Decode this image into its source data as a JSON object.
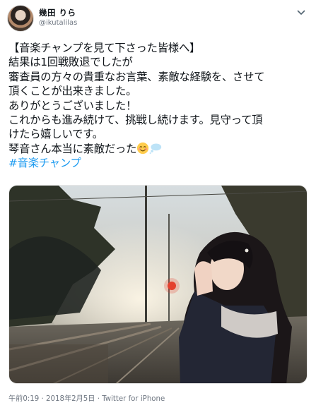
{
  "author": {
    "display_name": "幾田 りら",
    "handle": "@ikutalilas"
  },
  "tweet": {
    "lines": [
      "【音楽チャンプを見て下さった皆様へ】",
      "結果は1回戦敗退でしたが",
      "審査員の方々の貴重なお言葉、素敵な経験を、させて",
      "頂くことが出来きました。",
      "ありがとうございました！",
      "これからも進み続けて、挑戦し続けます。見守って頂",
      "けたら嬉しいです。",
      "琴音さん本当に素敵だった"
    ],
    "hashtag": "#音楽チャンプ",
    "emojis": [
      "smiling-blush-emoji",
      "thought-bubble-emoji"
    ]
  },
  "meta": {
    "time": "午前0:19",
    "date": "2018年2月5日",
    "separator": "·",
    "source": "Twitter for iPhone"
  },
  "colors": {
    "link": "#1d9bf0",
    "secondary_text": "#6e7681",
    "primary_text": "#0f1419"
  }
}
